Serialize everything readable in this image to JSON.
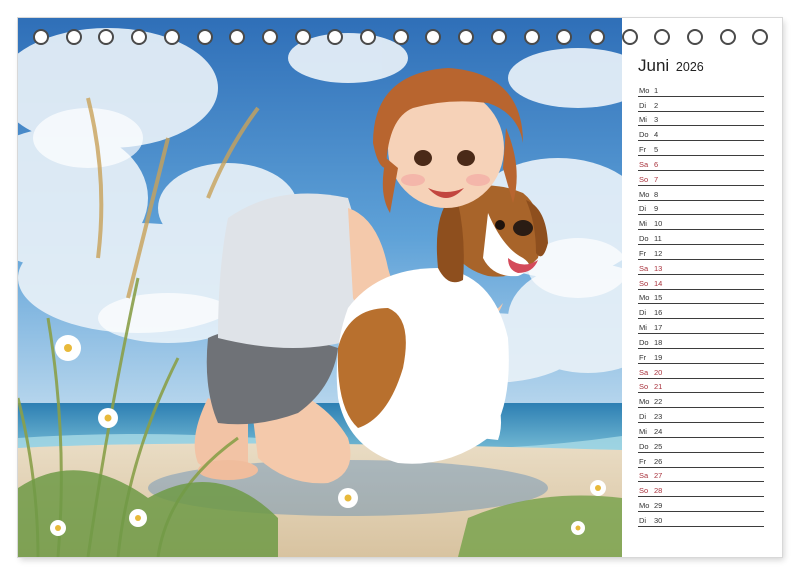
{
  "calendar": {
    "month": "Juni",
    "year": "2026",
    "days": [
      {
        "wd": "Mo",
        "n": "1",
        "we": false
      },
      {
        "wd": "Di",
        "n": "2",
        "we": false
      },
      {
        "wd": "Mi",
        "n": "3",
        "we": false
      },
      {
        "wd": "Do",
        "n": "4",
        "we": false
      },
      {
        "wd": "Fr",
        "n": "5",
        "we": false
      },
      {
        "wd": "Sa",
        "n": "6",
        "we": true
      },
      {
        "wd": "So",
        "n": "7",
        "we": true
      },
      {
        "wd": "Mo",
        "n": "8",
        "we": false
      },
      {
        "wd": "Di",
        "n": "9",
        "we": false
      },
      {
        "wd": "Mi",
        "n": "10",
        "we": false
      },
      {
        "wd": "Do",
        "n": "11",
        "we": false
      },
      {
        "wd": "Fr",
        "n": "12",
        "we": false
      },
      {
        "wd": "Sa",
        "n": "13",
        "we": true
      },
      {
        "wd": "So",
        "n": "14",
        "we": true
      },
      {
        "wd": "Mo",
        "n": "15",
        "we": false
      },
      {
        "wd": "Di",
        "n": "16",
        "we": false
      },
      {
        "wd": "Mi",
        "n": "17",
        "we": false
      },
      {
        "wd": "Do",
        "n": "18",
        "we": false
      },
      {
        "wd": "Fr",
        "n": "19",
        "we": false
      },
      {
        "wd": "Sa",
        "n": "20",
        "we": true
      },
      {
        "wd": "So",
        "n": "21",
        "we": true
      },
      {
        "wd": "Mo",
        "n": "22",
        "we": false
      },
      {
        "wd": "Di",
        "n": "23",
        "we": false
      },
      {
        "wd": "Mi",
        "n": "24",
        "we": false
      },
      {
        "wd": "Do",
        "n": "25",
        "we": false
      },
      {
        "wd": "Fr",
        "n": "26",
        "we": false
      },
      {
        "wd": "Sa",
        "n": "27",
        "we": true
      },
      {
        "wd": "So",
        "n": "28",
        "we": true
      },
      {
        "wd": "Mo",
        "n": "29",
        "we": false
      },
      {
        "wd": "Di",
        "n": "30",
        "we": false
      }
    ]
  },
  "colors": {
    "weekend": "#a8323c",
    "ring": "#4a4a4a"
  },
  "binding": {
    "ring_count": 23
  }
}
